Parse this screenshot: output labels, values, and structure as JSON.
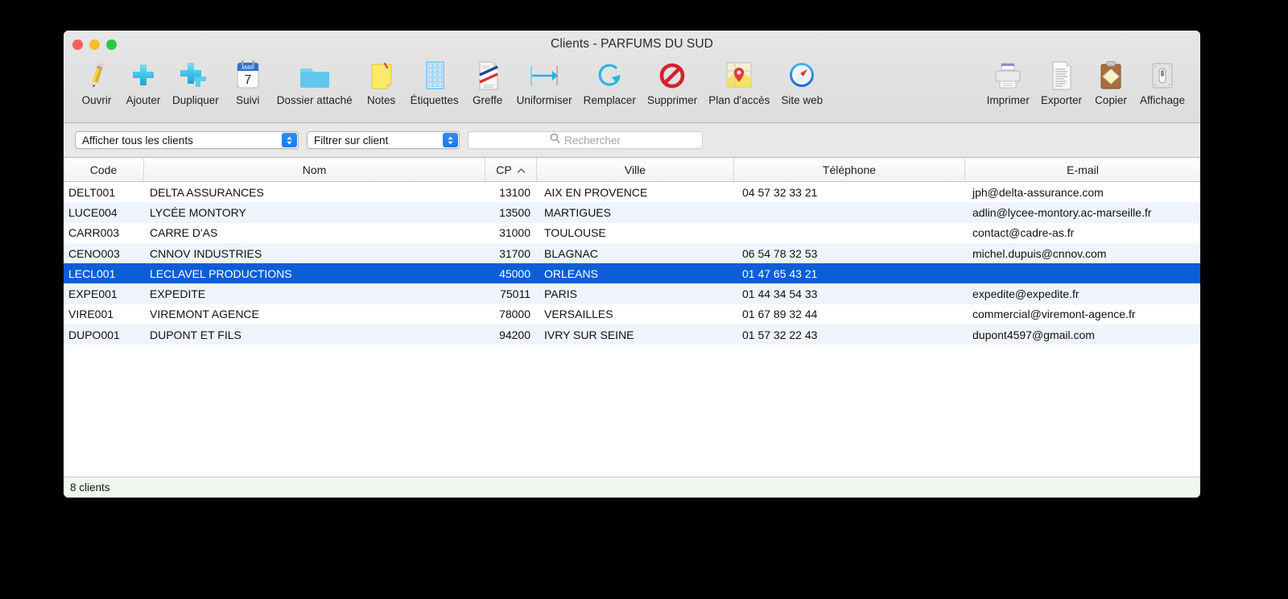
{
  "window": {
    "title": "Clients - PARFUMS DU SUD",
    "traffic_lights": [
      {
        "name": "close",
        "color": "#ff5f57"
      },
      {
        "name": "minimize",
        "color": "#febc2e"
      },
      {
        "name": "zoom",
        "color": "#28c840"
      }
    ]
  },
  "toolbar": {
    "left_items": [
      {
        "icon": "pencil-icon",
        "label": "Ouvrir"
      },
      {
        "icon": "plus-icon",
        "label": "Ajouter"
      },
      {
        "icon": "duplicate-plus-icon",
        "label": "Dupliquer"
      },
      {
        "icon": "calendar-icon",
        "label": "Suivi"
      },
      {
        "icon": "folder-icon",
        "label": "Dossier attaché"
      },
      {
        "icon": "notes-icon",
        "label": "Notes"
      },
      {
        "icon": "labels-grid-icon",
        "label": "Étiquettes"
      },
      {
        "icon": "document-tricolor-icon",
        "label": "Greffe"
      },
      {
        "icon": "arrow-right-icon",
        "label": "Uniformiser"
      },
      {
        "icon": "refresh-circle-icon",
        "label": "Remplacer"
      },
      {
        "icon": "forbidden-icon",
        "label": "Supprimer"
      },
      {
        "icon": "map-pin-icon",
        "label": "Plan d'accès"
      },
      {
        "icon": "safari-compass-icon",
        "label": "Site web"
      }
    ],
    "right_items": [
      {
        "icon": "printer-icon",
        "label": "Imprimer"
      },
      {
        "icon": "export-document-icon",
        "label": "Exporter"
      },
      {
        "icon": "clipboard-icon",
        "label": "Copier"
      },
      {
        "icon": "display-switch-icon",
        "label": "Affichage"
      }
    ],
    "calendar_month": "MAR",
    "calendar_day": "7"
  },
  "filterbar": {
    "show_popup": {
      "name": "show-all-clients-popup",
      "value": "Afficher tous les clients"
    },
    "filter_popup": {
      "name": "filter-on-client-popup",
      "value": "Filtrer sur client"
    },
    "search": {
      "name": "search-field",
      "value": "",
      "placeholder": "Rechercher",
      "icon": "search-icon"
    }
  },
  "table": {
    "columns": [
      {
        "key": "code",
        "label": "Code",
        "sorted": false
      },
      {
        "key": "nom",
        "label": "Nom",
        "sorted": false
      },
      {
        "key": "cp",
        "label": "CP",
        "sorted": true,
        "sort_direction": "ascending",
        "sort_glyph": "^"
      },
      {
        "key": "ville",
        "label": "Ville",
        "sorted": false
      },
      {
        "key": "tel",
        "label": "Téléphone",
        "sorted": false
      },
      {
        "key": "mail",
        "label": "E-mail",
        "sorted": false
      }
    ],
    "rows": [
      {
        "code": "DELT001",
        "nom": "DELTA ASSURANCES",
        "cp": "13100",
        "ville": "AIX EN PROVENCE",
        "tel": "04 57 32 33 21",
        "mail": "jph@delta-assurance.com",
        "selected": false
      },
      {
        "code": "LUCE004",
        "nom": "LYCÉE MONTORY",
        "cp": "13500",
        "ville": "MARTIGUES",
        "tel": "",
        "mail": "adlin@lycee-montory.ac-marseille.fr",
        "selected": false
      },
      {
        "code": "CARR003",
        "nom": "CARRE D'AS",
        "cp": "31000",
        "ville": "TOULOUSE",
        "tel": "",
        "mail": "contact@cadre-as.fr",
        "selected": false
      },
      {
        "code": "CENO003",
        "nom": "CNNOV INDUSTRIES",
        "cp": "31700",
        "ville": "BLAGNAC",
        "tel": "06 54 78 32 53",
        "mail": "michel.dupuis@cnnov.com",
        "selected": false
      },
      {
        "code": "LECL001",
        "nom": "LECLAVEL PRODUCTIONS",
        "cp": "45000",
        "ville": "ORLEANS",
        "tel": "01 47 65 43 21",
        "mail": "",
        "selected": true
      },
      {
        "code": "EXPE001",
        "nom": "EXPEDITE",
        "cp": "75011",
        "ville": "PARIS",
        "tel": "01 44 34 54 33",
        "mail": "expedite@expedite.fr",
        "selected": false
      },
      {
        "code": "VIRE001",
        "nom": "VIREMONT AGENCE",
        "cp": "78000",
        "ville": "VERSAILLES",
        "tel": "01 67 89 32 44",
        "mail": "commercial@viremont-agence.fr",
        "selected": false
      },
      {
        "code": "DUPO001",
        "nom": "DUPONT ET FILS",
        "cp": "94200",
        "ville": "IVRY SUR SEINE",
        "tel": "01 57 32 22 43",
        "mail": "dupont4597@gmail.com",
        "selected": false
      }
    ]
  },
  "status": {
    "text": "8 clients"
  },
  "colors": {
    "selection_blue": "#0b5ed7",
    "alt_row": "#eff4fc",
    "toolbar_bg": "#e1e1e1",
    "filterbar_bg": "#e8e8e8",
    "status_bg": "#f2f7f0"
  }
}
